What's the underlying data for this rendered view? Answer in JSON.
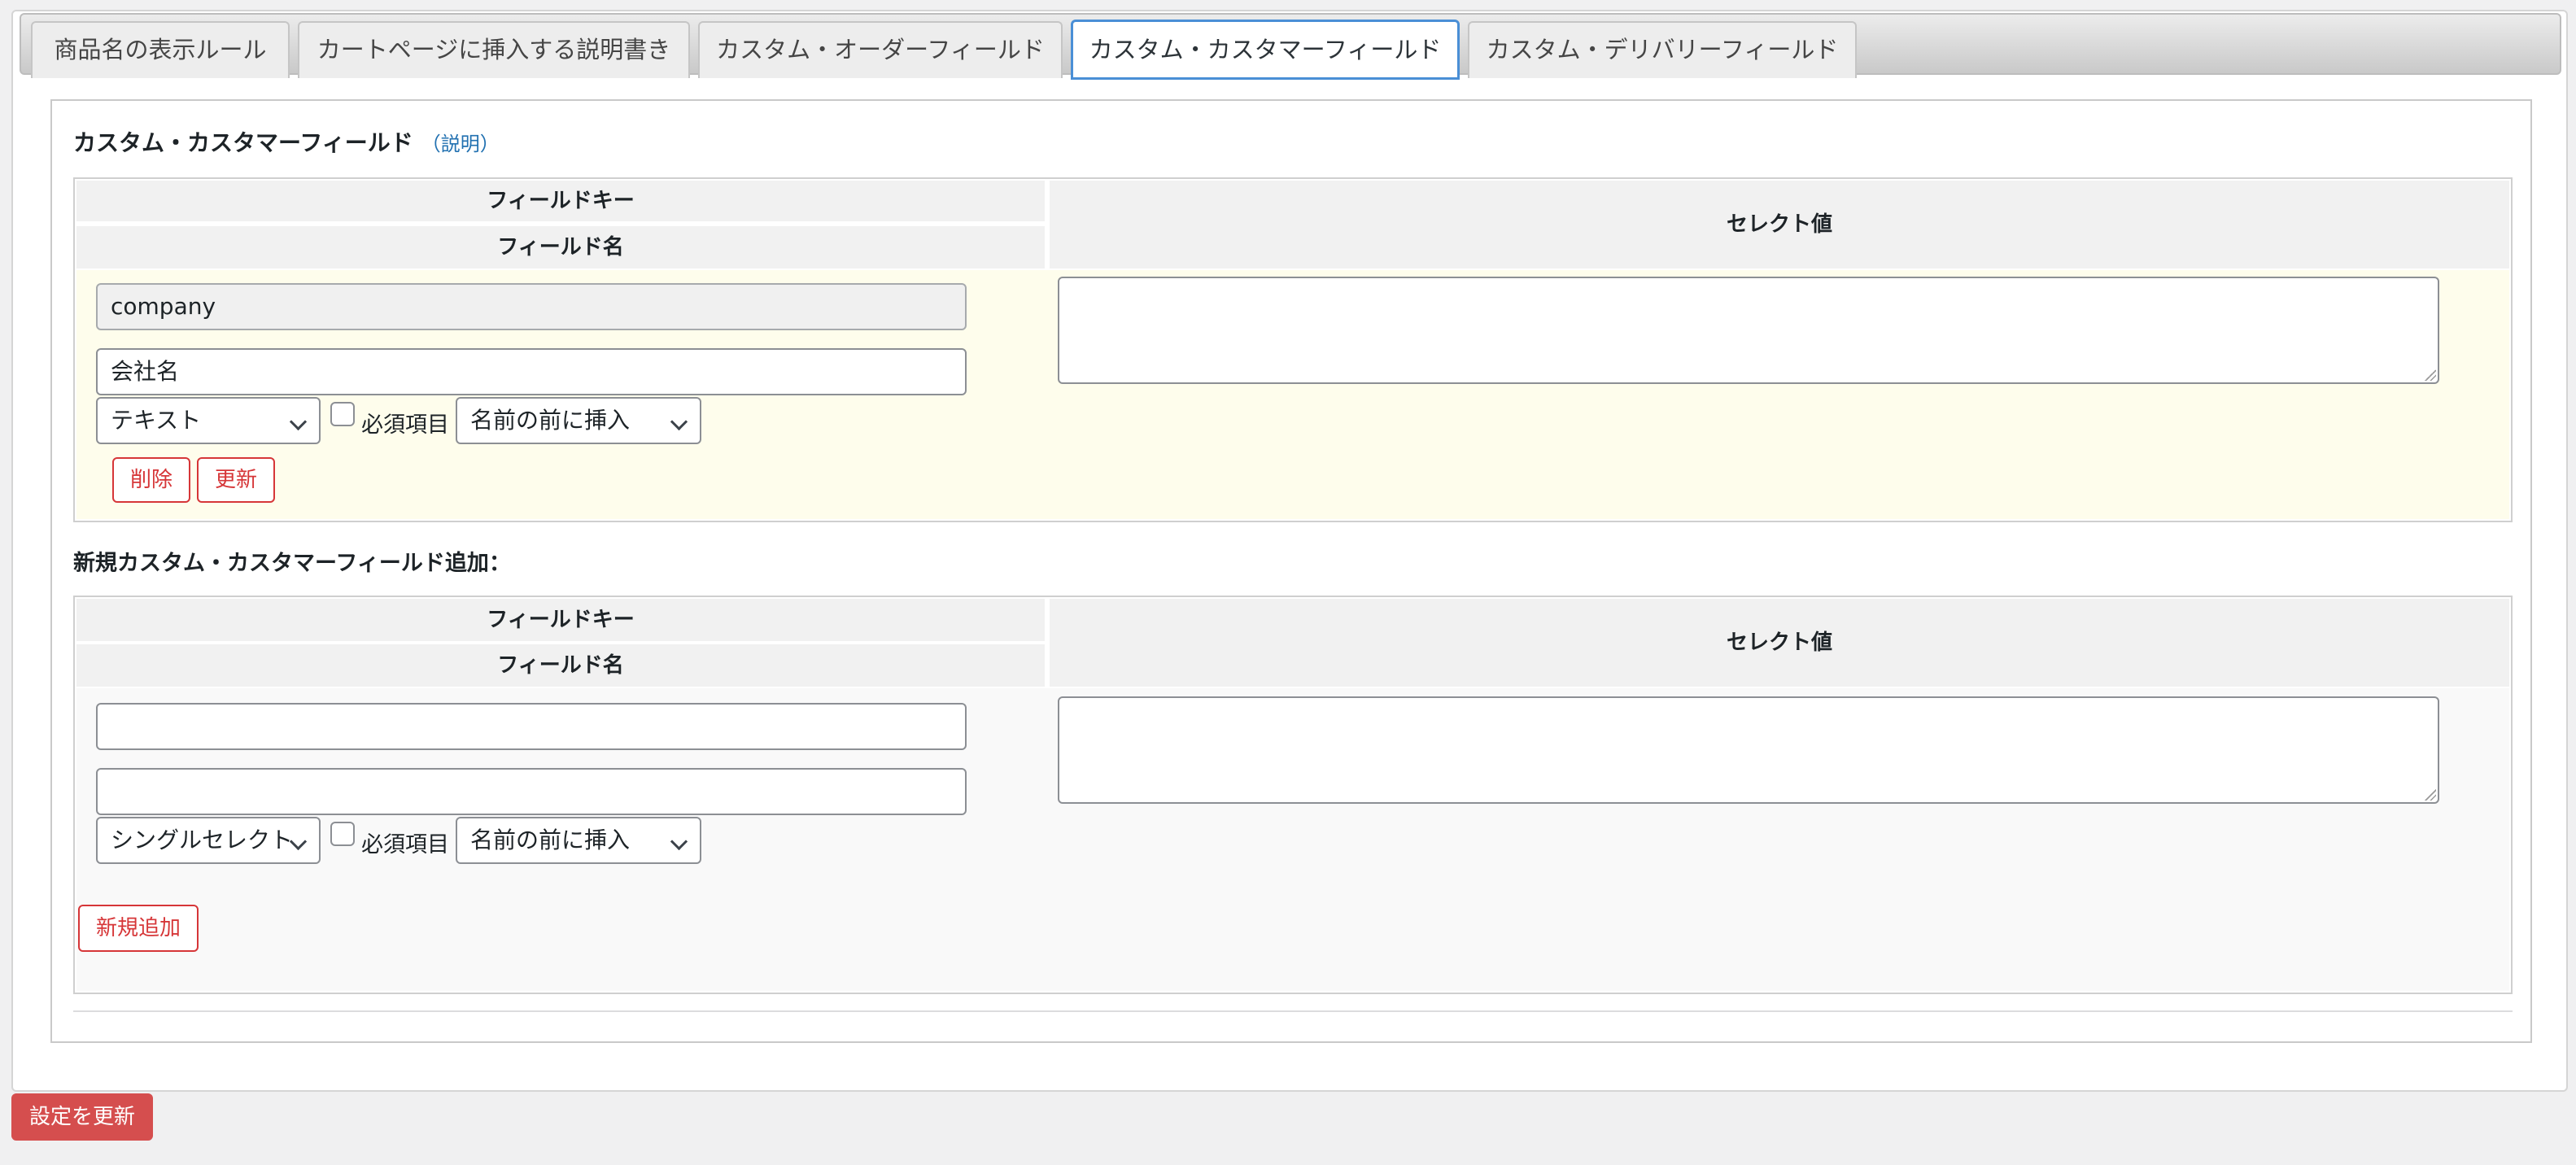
{
  "tabs": [
    {
      "label": "商品名の表示ルール",
      "active": false
    },
    {
      "label": "カートページに挿入する説明書き",
      "active": false
    },
    {
      "label": "カスタム・オーダーフィールド",
      "active": false
    },
    {
      "label": "カスタム・カスタマーフィールド",
      "active": true
    },
    {
      "label": "カスタム・デリバリーフィールド",
      "active": false
    }
  ],
  "section": {
    "title": "カスタム・カスタマーフィールド",
    "help_link": "（説明）"
  },
  "table_headers": {
    "field_key": "フィールドキー",
    "field_name": "フィールド名",
    "select_values": "セレクト値"
  },
  "existing_field": {
    "key_value": "company",
    "name_value": "会社名",
    "type_selected": "テキスト",
    "required_label": "必須項目",
    "required_checked": false,
    "position_selected": "名前の前に挿入",
    "delete_label": "削除",
    "update_label": "更新",
    "row_bg": "#fefdec"
  },
  "new_field": {
    "heading": "新規カスタム・カスタマーフィールド追加：",
    "key_value": "",
    "name_value": "",
    "type_selected": "シングルセレクト",
    "required_label": "必須項目",
    "required_checked": false,
    "position_selected": "名前の前に挿入",
    "add_label": "新規追加",
    "row_bg": "#f9f9f9"
  },
  "footer": {
    "save_label": "設定を更新"
  },
  "colors": {
    "danger": "#d63638",
    "primary_button": "#d54e4e",
    "link": "#2271b1",
    "active_tab_border": "#4a8fd6"
  }
}
